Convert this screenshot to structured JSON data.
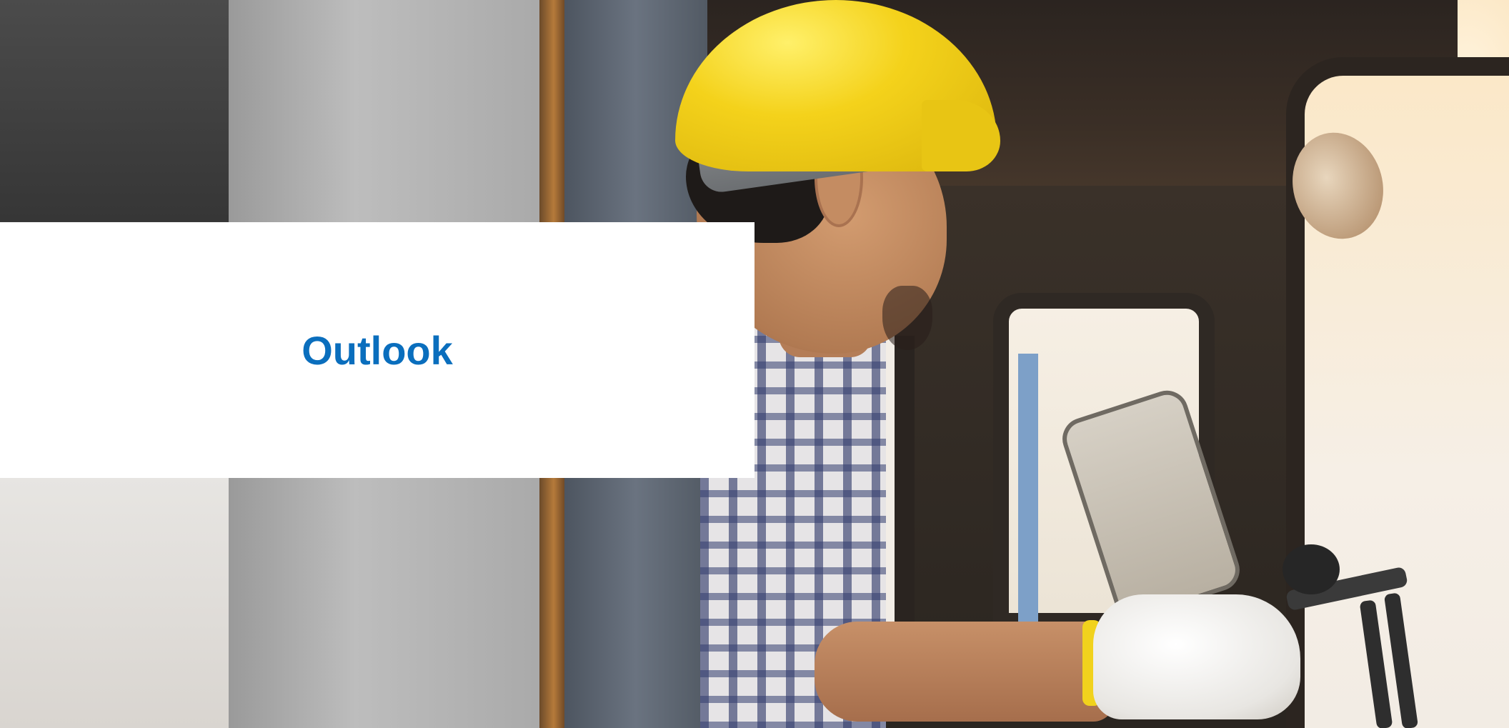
{
  "slide": {
    "title": "Outlook",
    "title_color": "#0a6ebd",
    "panel_color": "#ffffff",
    "background_image": "construction-worker-in-excavator-cab-photo"
  }
}
